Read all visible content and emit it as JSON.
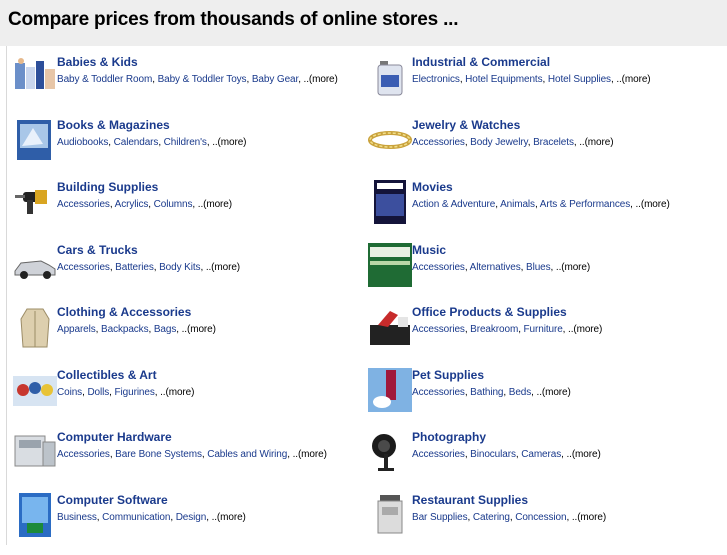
{
  "header": {
    "title": "Compare prices from thousands of online stores ..."
  },
  "more_label": "..(more)",
  "categories": [
    {
      "title": "Babies & Kids",
      "links": [
        "Baby & Toddler Room",
        "Baby & Toddler Toys",
        "Baby Gear"
      ],
      "icon": "baby-products-icon"
    },
    {
      "title": "Industrial & Commercial",
      "links": [
        "Electronics",
        "Hotel Equipments",
        "Hotel Supplies"
      ],
      "icon": "industrial-jug-icon"
    },
    {
      "title": "Books & Magazines",
      "links": [
        "Audiobooks",
        "Calendars",
        "Children's"
      ],
      "icon": "book-icon"
    },
    {
      "title": "Jewelry & Watches",
      "links": [
        "Accessories",
        "Body Jewelry",
        "Bracelets"
      ],
      "icon": "bracelet-icon"
    },
    {
      "title": "Building Supplies",
      "links": [
        "Accessories",
        "Acrylics",
        "Columns"
      ],
      "icon": "power-tool-icon"
    },
    {
      "title": "Movies",
      "links": [
        "Action & Adventure",
        "Animals",
        "Arts & Performances"
      ],
      "icon": "movie-cover-icon"
    },
    {
      "title": "Cars & Trucks",
      "links": [
        "Accessories",
        "Batteries",
        "Body Kits"
      ],
      "icon": "car-icon"
    },
    {
      "title": "Music",
      "links": [
        "Accessories",
        "Alternatives",
        "Blues"
      ],
      "icon": "music-cd-icon"
    },
    {
      "title": "Clothing & Accessories",
      "links": [
        "Apparels",
        "Backpacks",
        "Bags"
      ],
      "icon": "coat-icon"
    },
    {
      "title": "Office Products & Supplies",
      "links": [
        "Accessories",
        "Breakroom",
        "Furniture"
      ],
      "icon": "office-supplies-icon"
    },
    {
      "title": "Collectibles & Art",
      "links": [
        "Coins",
        "Dolls",
        "Figurines"
      ],
      "icon": "collectible-figures-icon"
    },
    {
      "title": "Pet Supplies",
      "links": [
        "Accessories",
        "Bathing",
        "Beds"
      ],
      "icon": "pet-icon"
    },
    {
      "title": "Computer Hardware",
      "links": [
        "Accessories",
        "Bare Bone Systems",
        "Cables and Wiring"
      ],
      "icon": "computer-hardware-icon"
    },
    {
      "title": "Photography",
      "links": [
        "Accessories",
        "Binoculars",
        "Cameras"
      ],
      "icon": "camera-icon"
    },
    {
      "title": "Computer Software",
      "links": [
        "Business",
        "Communication",
        "Design"
      ],
      "icon": "software-box-icon"
    },
    {
      "title": "Restaurant Supplies",
      "links": [
        "Bar Supplies",
        "Catering",
        "Concession"
      ],
      "icon": "restaurant-equipment-icon"
    }
  ]
}
